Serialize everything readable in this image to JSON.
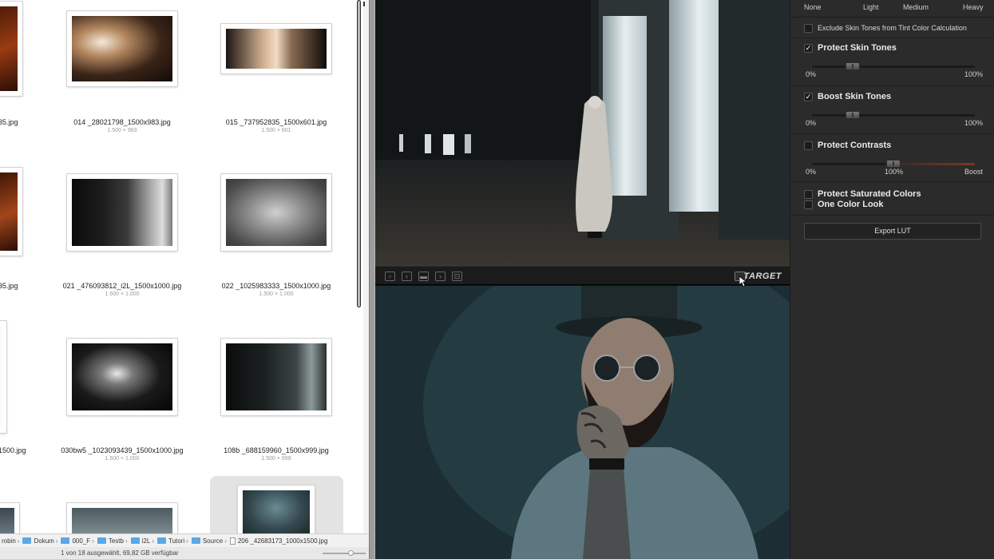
{
  "finder": {
    "files": [
      {
        "name": "014 _28021798_1500x983.jpg",
        "dims": "1.500 × 983"
      },
      {
        "name": "015 _737952835_1500x601.jpg",
        "dims": "1.500 × 601"
      },
      {
        "name": "021 _476093812_i2L_1500x1000.jpg",
        "dims": "1.500 × 1.000"
      },
      {
        "name": "022 _1025983333_1500x1000.jpg",
        "dims": "1.500 × 1.000"
      },
      {
        "name": "030bw5 _1023093439_1500x1000.jpg",
        "dims": "1.500 × 1.000"
      },
      {
        "name": "108b _688159960_1500x999.jpg",
        "dims": "1.500 × 999"
      }
    ],
    "partial_names": [
      "35.jpg",
      "35.jpg",
      "1500.jpg"
    ],
    "path": [
      "robin",
      "Dokum",
      "000_F",
      "Testb",
      "i2L",
      "Tutori",
      "Source",
      "206 _42683173_1000x1500.jpg"
    ],
    "status": "1 von 18 ausgewählt, 69,82 GB verfügbar"
  },
  "preview": {
    "target_label": "TARGET"
  },
  "panel": {
    "tint_levels": [
      "None",
      "Light",
      "Medium",
      "Heavy"
    ],
    "exclude_skin_label": "Exclude Skin Tones from Tint Color Calculation",
    "protect_skin": {
      "label": "Protect Skin Tones",
      "checked": true,
      "value": 0.25,
      "min": "0%",
      "max": "100%"
    },
    "boost_skin": {
      "label": "Boost Skin Tones",
      "checked": true,
      "value": 0.25,
      "min": "0%",
      "max": "100%"
    },
    "protect_contrasts": {
      "label": "Protect Contrasts",
      "checked": false,
      "value": 0.5,
      "min": "0%",
      "mid": "100%",
      "max": "Boost"
    },
    "protect_saturated": {
      "label": "Protect Saturated Colors",
      "checked": false
    },
    "one_color_look": {
      "label": "One Color Look",
      "checked": false
    },
    "export_label": "Export LUT",
    "check_mark": "✓"
  }
}
